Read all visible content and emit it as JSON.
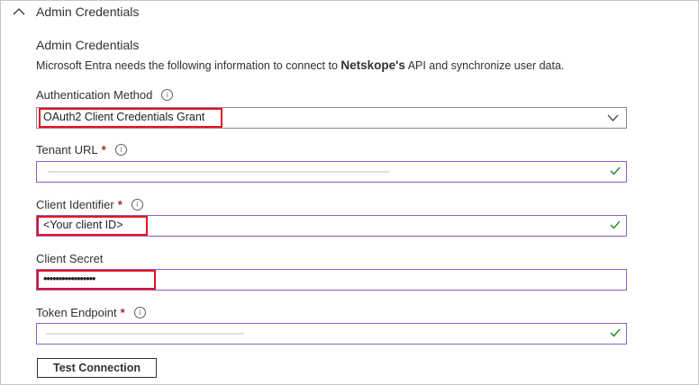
{
  "section": {
    "title": "Admin Credentials"
  },
  "subheading": "Admin Credentials",
  "description": {
    "prefix": "Microsoft Entra needs the following information to connect to",
    "product": "Netskope's",
    "suffix": "API and synchronize user data."
  },
  "fields": {
    "auth_method": {
      "label": "Authentication Method",
      "value": "OAuth2 Client Credentials Grant"
    },
    "tenant_url": {
      "label": "Tenant URL",
      "required": "*",
      "value": ""
    },
    "client_id": {
      "label": "Client Identifier",
      "required": "*",
      "value": "<Your client ID>"
    },
    "client_secret": {
      "label": "Client Secret",
      "value": "•••••••••••••••••"
    },
    "token_endpoint": {
      "label": "Token Endpoint",
      "required": "*",
      "value": ""
    }
  },
  "info_glyph": "i",
  "test_button": "Test Connection",
  "colors": {
    "highlight": "#e81123",
    "valid": "#107c10",
    "focus_border": "#8661c5",
    "required": "#a4262c"
  },
  "icons": {
    "collapse": "chevron-up-icon",
    "info": "info-icon",
    "valid": "checkmark-icon",
    "dropdown": "chevron-down-icon"
  }
}
